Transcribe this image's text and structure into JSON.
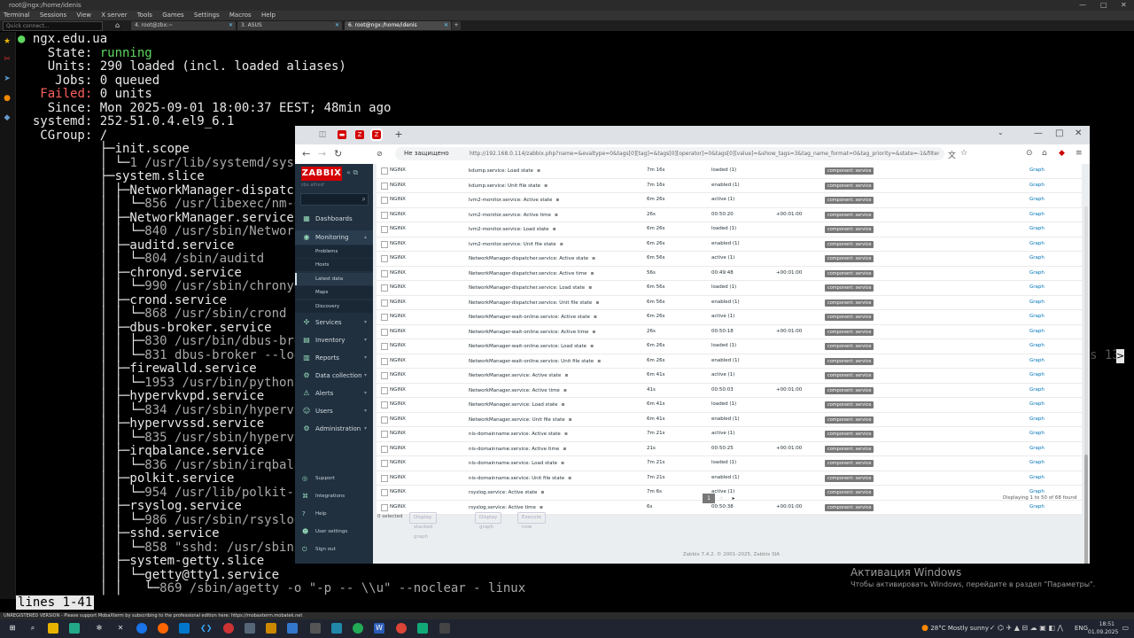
{
  "moba": {
    "title": "root@ngx:/home/idenis",
    "menu": [
      "Terminal",
      "Sessions",
      "View",
      "X server",
      "Tools",
      "Games",
      "Settings",
      "Macros",
      "Help"
    ],
    "quick_connect": "Quick connect...",
    "tabs": [
      {
        "label": "4. root@zbx:~",
        "active": false
      },
      {
        "label": "3. ASUS",
        "active": false
      },
      {
        "label": "6. root@ngx:/home/idenis",
        "active": true
      }
    ],
    "status": "UNREGISTERED VERSION  -  Please support MobaXterm by subscribing to the professional edition here:  https://mobaxterm.mobatek.net"
  },
  "terminal": {
    "lines": [
      {
        "pre": "",
        "bullet": "●",
        "text": " ngx.edu.ua"
      },
      {
        "pre": "    State: ",
        "val": "running",
        "cls": "green"
      },
      {
        "pre": "    Units: 290 loaded (incl. loaded aliases)"
      },
      {
        "pre": "     Jobs: 0 queued"
      },
      {
        "pre": "   ",
        "val": "Failed:",
        "cls": "red",
        "post": " 0 units"
      },
      {
        "pre": "    Since: Mon 2025-09-01 18:00:37 EEST; 48min ago"
      },
      {
        "pre": "  systemd: 252-51.0.4.el9_6.1"
      },
      {
        "pre": "   CGroup: /"
      },
      {
        "pre": "           ├─init.scope"
      },
      {
        "pre": "           │ └─",
        "val": "1 /usr/lib/systemd/syste",
        "cls": "grey"
      },
      {
        "pre": "           ├─system.slice"
      },
      {
        "pre": "           │ ├─NetworkManager-dispatche"
      },
      {
        "pre": "           │ │ └─",
        "val": "856 /usr/libexec/nm-di",
        "cls": "grey"
      },
      {
        "pre": "           │ ├─NetworkManager.service"
      },
      {
        "pre": "           │ │ └─",
        "val": "840 /usr/sbin/NetworkM",
        "cls": "grey"
      },
      {
        "pre": "           │ ├─auditd.service"
      },
      {
        "pre": "           │ │ └─",
        "val": "804 /sbin/auditd",
        "cls": "grey"
      },
      {
        "pre": "           │ ├─chronyd.service"
      },
      {
        "pre": "           │ │ └─",
        "val": "990 /usr/sbin/chronyd",
        "cls": "grey"
      },
      {
        "pre": "           │ ├─crond.service"
      },
      {
        "pre": "           │ │ └─",
        "val": "868 /usr/sbin/crond -n",
        "cls": "grey"
      },
      {
        "pre": "           │ ├─dbus-broker.service"
      },
      {
        "pre": "           │ │ ├─",
        "val": "830 /usr/bin/dbus-brok",
        "cls": "grey"
      },
      {
        "pre": "           │ │ └─",
        "val": "831 dbus-broker --log",
        "cls": "grey"
      },
      {
        "pre": "           │ ├─firewalld.service"
      },
      {
        "pre": "           │ │ └─",
        "val": "1953 /usr/bin/python3",
        "cls": "grey"
      },
      {
        "pre": "           │ ├─hypervkvpd.service"
      },
      {
        "pre": "           │ │ └─",
        "val": "834 /usr/sbin/hypervkv",
        "cls": "grey"
      },
      {
        "pre": "           │ ├─hypervvssd.service"
      },
      {
        "pre": "           │ │ └─",
        "val": "835 /usr/sbin/hypervvs",
        "cls": "grey"
      },
      {
        "pre": "           │ ├─irqbalance.service"
      },
      {
        "pre": "           │ │ └─",
        "val": "836 /usr/sbin/irqbalan",
        "cls": "grey"
      },
      {
        "pre": "           │ ├─polkit.service"
      },
      {
        "pre": "           │ │ └─",
        "val": "954 /usr/lib/polkit-1/",
        "cls": "grey"
      },
      {
        "pre": "           │ ├─rsyslog.service"
      },
      {
        "pre": "           │ │ └─",
        "val": "986 /usr/sbin/rsyslogd",
        "cls": "grey"
      },
      {
        "pre": "           │ ├─sshd.service"
      },
      {
        "pre": "           │ │ └─",
        "val": "858 \"sshd: /usr/sbin/",
        "cls": "grey"
      },
      {
        "pre": "           │ ├─system-getty.slice"
      },
      {
        "pre": "           │ │ └─getty@tty1.service"
      },
      {
        "pre": "           │ │   └─",
        "val": "869 /sbin/agetty -o \"-p -- \\\\u\" --noclear - linux",
        "cls": "grey"
      }
    ],
    "pager": "lines 1-41",
    "peek": "s 13",
    "peek_caret": ">"
  },
  "browser": {
    "insecure_label": "Не защищено",
    "url": "http://192.168.0.114/zabbix.php?name=&evaltype=0&tags[0][tag]=&tags[0][operator]=0&tags[0][value]=&show_tags=3&tag_name_format=0&tag_priority=&state=-1&filter"
  },
  "zabbix": {
    "logo": "ZABBIX",
    "host": "zbx.alfresf",
    "menu": [
      {
        "label": "Dashboards",
        "icon": "dashboard-icon"
      },
      {
        "label": "Monitoring",
        "icon": "monitoring-icon",
        "open": true
      },
      {
        "label": "Services",
        "icon": "services-icon"
      },
      {
        "label": "Inventory",
        "icon": "inventory-icon"
      },
      {
        "label": "Reports",
        "icon": "reports-icon"
      },
      {
        "label": "Data collection",
        "icon": "data-collection-icon"
      },
      {
        "label": "Alerts",
        "icon": "alerts-icon"
      },
      {
        "label": "Users",
        "icon": "users-icon"
      },
      {
        "label": "Administration",
        "icon": "administration-icon"
      }
    ],
    "monitoring_sub": [
      "Problems",
      "Hosts",
      "Latest data",
      "Maps",
      "Discovery"
    ],
    "selected_sub": "Latest data",
    "footer_menu": [
      "Support",
      "Integrations",
      "Help",
      "User settings",
      "Sign out"
    ],
    "rows": [
      {
        "host": "NGINX",
        "name": "kdump.service: Load state",
        "lastcheck": "7m 16s",
        "lastvalue": "loaded (1)",
        "change": "",
        "tag": "component: service",
        "link": "Graph"
      },
      {
        "host": "NGINX",
        "name": "kdump.service: Unit file state",
        "lastcheck": "7m 16s",
        "lastvalue": "enabled (1)",
        "change": "",
        "tag": "component: service",
        "link": "Graph"
      },
      {
        "host": "NGINX",
        "name": "lvm2-monitor.service: Active state",
        "lastcheck": "6m 26s",
        "lastvalue": "active (1)",
        "change": "",
        "tag": "component: service",
        "link": "Graph"
      },
      {
        "host": "NGINX",
        "name": "lvm2-monitor.service: Active time",
        "lastcheck": "26s",
        "lastvalue": "00:50:20",
        "change": "+00:01:00",
        "tag": "component: service",
        "link": "Graph"
      },
      {
        "host": "NGINX",
        "name": "lvm2-monitor.service: Load state",
        "lastcheck": "6m 26s",
        "lastvalue": "loaded (1)",
        "change": "",
        "tag": "component: service",
        "link": "Graph"
      },
      {
        "host": "NGINX",
        "name": "lvm2-monitor.service: Unit file state",
        "lastcheck": "6m 26s",
        "lastvalue": "enabled (1)",
        "change": "",
        "tag": "component: service",
        "link": "Graph"
      },
      {
        "host": "NGINX",
        "name": "NetworkManager-dispatcher.service: Active state",
        "lastcheck": "6m 56s",
        "lastvalue": "active (1)",
        "change": "",
        "tag": "component: service",
        "link": "Graph"
      },
      {
        "host": "NGINX",
        "name": "NetworkManager-dispatcher.service: Active time",
        "lastcheck": "56s",
        "lastvalue": "00:49:48",
        "change": "+00:01:00",
        "tag": "component: service",
        "link": "Graph"
      },
      {
        "host": "NGINX",
        "name": "NetworkManager-dispatcher.service: Load state",
        "lastcheck": "6m 56s",
        "lastvalue": "loaded (1)",
        "change": "",
        "tag": "component: service",
        "link": "Graph"
      },
      {
        "host": "NGINX",
        "name": "NetworkManager-dispatcher.service: Unit file state",
        "lastcheck": "6m 56s",
        "lastvalue": "enabled (1)",
        "change": "",
        "tag": "component: service",
        "link": "Graph"
      },
      {
        "host": "NGINX",
        "name": "NetworkManager-wait-online.service: Active state",
        "lastcheck": "6m 26s",
        "lastvalue": "active (1)",
        "change": "",
        "tag": "component: service",
        "link": "Graph"
      },
      {
        "host": "NGINX",
        "name": "NetworkManager-wait-online.service: Active time",
        "lastcheck": "26s",
        "lastvalue": "00:50:18",
        "change": "+00:01:00",
        "tag": "component: service",
        "link": "Graph"
      },
      {
        "host": "NGINX",
        "name": "NetworkManager-wait-online.service: Load state",
        "lastcheck": "6m 26s",
        "lastvalue": "loaded (1)",
        "change": "",
        "tag": "component: service",
        "link": "Graph"
      },
      {
        "host": "NGINX",
        "name": "NetworkManager-wait-online.service: Unit file state",
        "lastcheck": "6m 26s",
        "lastvalue": "enabled (1)",
        "change": "",
        "tag": "component: service",
        "link": "Graph"
      },
      {
        "host": "NGINX",
        "name": "NetworkManager.service: Active state",
        "lastcheck": "6m 41s",
        "lastvalue": "active (1)",
        "change": "",
        "tag": "component: service",
        "link": "Graph"
      },
      {
        "host": "NGINX",
        "name": "NetworkManager.service: Active time",
        "lastcheck": "41s",
        "lastvalue": "00:50:03",
        "change": "+00:01:00",
        "tag": "component: service",
        "link": "Graph"
      },
      {
        "host": "NGINX",
        "name": "NetworkManager.service: Load state",
        "lastcheck": "6m 41s",
        "lastvalue": "loaded (1)",
        "change": "",
        "tag": "component: service",
        "link": "Graph"
      },
      {
        "host": "NGINX",
        "name": "NetworkManager.service: Unit file state",
        "lastcheck": "6m 41s",
        "lastvalue": "enabled (1)",
        "change": "",
        "tag": "component: service",
        "link": "Graph"
      },
      {
        "host": "NGINX",
        "name": "nis-domainname.service: Active state",
        "lastcheck": "7m 21s",
        "lastvalue": "active (1)",
        "change": "",
        "tag": "component: service",
        "link": "Graph"
      },
      {
        "host": "NGINX",
        "name": "nis-domainname.service: Active time",
        "lastcheck": "21s",
        "lastvalue": "00:50:25",
        "change": "+00:01:00",
        "tag": "component: service",
        "link": "Graph"
      },
      {
        "host": "NGINX",
        "name": "nis-domainname.service: Load state",
        "lastcheck": "7m 21s",
        "lastvalue": "loaded (1)",
        "change": "",
        "tag": "component: service",
        "link": "Graph"
      },
      {
        "host": "NGINX",
        "name": "nis-domainname.service: Unit file state",
        "lastcheck": "7m 21s",
        "lastvalue": "enabled (1)",
        "change": "",
        "tag": "component: service",
        "link": "Graph"
      },
      {
        "host": "NGINX",
        "name": "rsyslog.service: Active state",
        "lastcheck": "7m 6s",
        "lastvalue": "active (1)",
        "change": "",
        "tag": "component: service",
        "link": "Graph"
      },
      {
        "host": "NGINX",
        "name": "rsyslog.service: Active time",
        "lastcheck": "6s",
        "lastvalue": "00:50:38",
        "change": "+00:01:00",
        "tag": "component: service",
        "link": "Graph"
      }
    ],
    "pagination": {
      "current": "1",
      "next_icon": "next-page-icon"
    },
    "displaying": "Displaying 1 to 50 of 68 found",
    "selected": "0 selected",
    "mass_buttons": [
      "Display stacked graph",
      "Display graph",
      "Execute now"
    ],
    "footer": "Zabbix 7.4.2. © 2001–2025, Zabbix SIA"
  },
  "watermark": {
    "line1": "Активация Windows",
    "line2": "Чтобы активировать Windows, перейдите в раздел \"Параметры\"."
  },
  "taskbar": {
    "weather": "28°C  Mostly sunny",
    "lang": "ENG",
    "time": "18:51",
    "date": "01.09.2025"
  },
  "colors": {
    "zabbix_sidebar": "#20303f",
    "zabbix_red": "#d40000",
    "link": "#0275b8",
    "terminal_green": "#5fd75f",
    "terminal_red": "#ff5f5f"
  }
}
